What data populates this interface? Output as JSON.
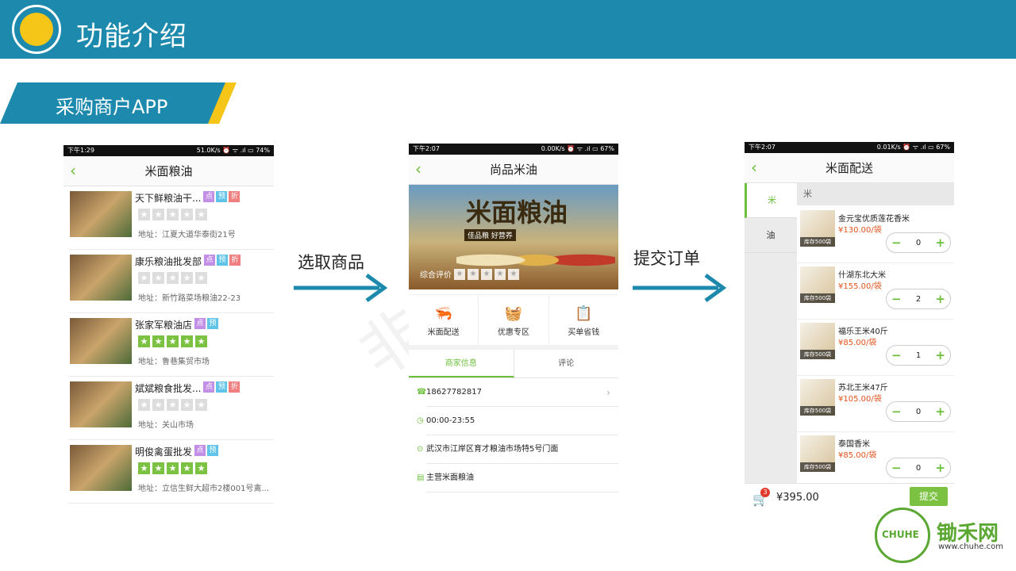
{
  "header": {
    "title": "功能介绍"
  },
  "section": {
    "title": "采购商户APP"
  },
  "steps": {
    "step1": "选取商品",
    "step2": "提交订单"
  },
  "watermark": "非会员印",
  "colors": {
    "primary": "#1d8aad",
    "accent": "#f5c518",
    "green": "#7cc242"
  },
  "phone1": {
    "status_left": "下午1:29",
    "status_right": "51.0K/s ⏰ ᯤ .ıl ▭ 74%",
    "title": "米面粮油",
    "stores": [
      {
        "name": "天下鲜粮油干...",
        "badges": [
          "点",
          "预",
          "折"
        ],
        "rated": 0,
        "addr": "地址：江夏大道华泰街21号"
      },
      {
        "name": "康乐粮油批发部",
        "badges": [
          "点",
          "预",
          "折"
        ],
        "rated": 0,
        "addr": "地址：新竹路菜场粮油22-23"
      },
      {
        "name": "张家军粮油店",
        "badges": [
          "点",
          "预"
        ],
        "rated": 5,
        "addr": "地址：鲁巷集贸市场"
      },
      {
        "name": "斌斌粮食批发...",
        "badges": [
          "点",
          "预",
          "折"
        ],
        "rated": 0,
        "addr": "地址：关山市场"
      },
      {
        "name": "明俊禽蛋批发",
        "badges": [
          "点",
          "预"
        ],
        "rated": 5,
        "addr": "地址：立信生鲜大超市2楼001号禽..."
      }
    ]
  },
  "phone2": {
    "status_left": "下午2:07",
    "status_right": "0.00K/s ⏰ ᯤ .ıl ▭ 67%",
    "title": "尚品米油",
    "banner_title": "米面粮油",
    "banner_sub": "佳品粮 好营养",
    "rating_label": "综合评价",
    "quick": [
      {
        "icon": "🦐",
        "label": "米面配送"
      },
      {
        "icon": "🧺",
        "label": "优惠专区"
      },
      {
        "icon": "📋",
        "label": "买单省钱"
      }
    ],
    "tabs": [
      "商家信息",
      "评论"
    ],
    "info": [
      {
        "icon": "☎",
        "text": "18627782817"
      },
      {
        "icon": "◷",
        "text": "00:00-23:55"
      },
      {
        "icon": "⊙",
        "text": "武汉市江岸区育才粮油市场特5号门面"
      },
      {
        "icon": "▤",
        "text": "主营米面粮油"
      }
    ]
  },
  "phone3": {
    "status_left": "下午2:07",
    "status_right": "0.01K/s ⏰ ᯤ .ıl ▭ 67%",
    "title": "米面配送",
    "categories": [
      "米",
      "油"
    ],
    "category_head": "米",
    "items": [
      {
        "name": "金元宝优质莲花香米",
        "price": "¥130.00/袋",
        "stock": "库存500袋",
        "qty": "0"
      },
      {
        "name": "什湖东北大米",
        "price": "¥155.00/袋",
        "stock": "库存500袋",
        "qty": "2"
      },
      {
        "name": "福乐王米40斤",
        "price": "¥85.00/袋",
        "stock": "库存500袋",
        "qty": "1"
      },
      {
        "name": "苏北王米47斤",
        "price": "¥105.00/袋",
        "stock": "库存500袋",
        "qty": "0"
      },
      {
        "name": "泰国香米",
        "price": "¥85.00/袋",
        "stock": "库存500袋",
        "qty": "0"
      }
    ],
    "cart_count": "3",
    "total": "¥395.00",
    "submit": "提交"
  },
  "brand": {
    "logo_text": "CHUHE",
    "name": "锄禾网",
    "url": "www.chuhe.com"
  }
}
